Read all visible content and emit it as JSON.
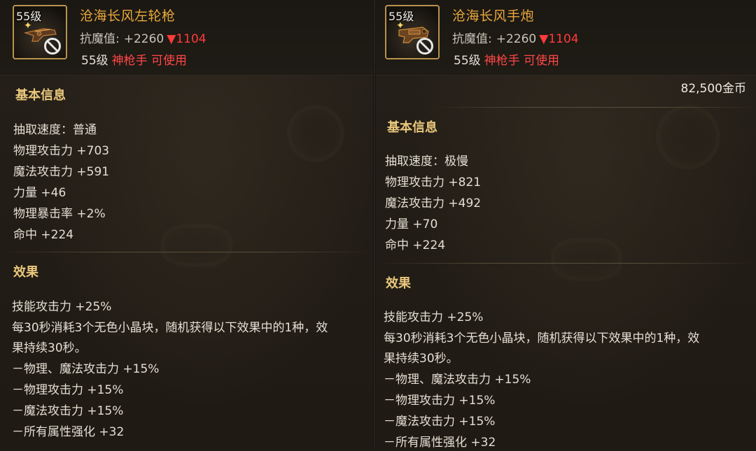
{
  "left": {
    "level_badge": "55级",
    "name": "沧海长风左轮枪",
    "resist_label": "抗魔值:",
    "resist_value": "+2260",
    "resist_down": "▼1104",
    "req_level": "55级",
    "req_class": "神枪手 可使用",
    "basic_title": "基本信息",
    "stats": [
      "抽取速度：普通",
      "物理攻击力 +703",
      "魔法攻击力 +591",
      "力量 +46",
      "物理暴击率 +2%",
      "命中 +224"
    ],
    "effect_title": "效果",
    "effects": [
      "技能攻击力 +25%",
      "每30秒消耗3个无色小晶块，随机获得以下效果中的1种，效",
      "果持续30秒。",
      "－物理、魔法攻击力 +15%",
      "－物理攻击力 +15%",
      "－魔法攻击力 +15%",
      "－所有属性强化 +32"
    ]
  },
  "right": {
    "level_badge": "55级",
    "name": "沧海长风手炮",
    "resist_label": "抗魔值:",
    "resist_value": "+2260",
    "resist_down": "▼1104",
    "req_level": "55级",
    "req_class": "神枪手 可使用",
    "price": "82,500金币",
    "basic_title": "基本信息",
    "stats": [
      "抽取速度：极慢",
      "物理攻击力 +821",
      "魔法攻击力 +492",
      "力量 +70",
      "命中 +224"
    ],
    "effect_title": "效果",
    "effects": [
      "技能攻击力 +25%",
      "每30秒消耗3个无色小晶块，随机获得以下效果中的1种，效",
      "果持续30秒。",
      "－物理、魔法攻击力 +15%",
      "－物理攻击力 +15%",
      "－魔法攻击力 +15%",
      "－所有属性强化 +32"
    ]
  }
}
